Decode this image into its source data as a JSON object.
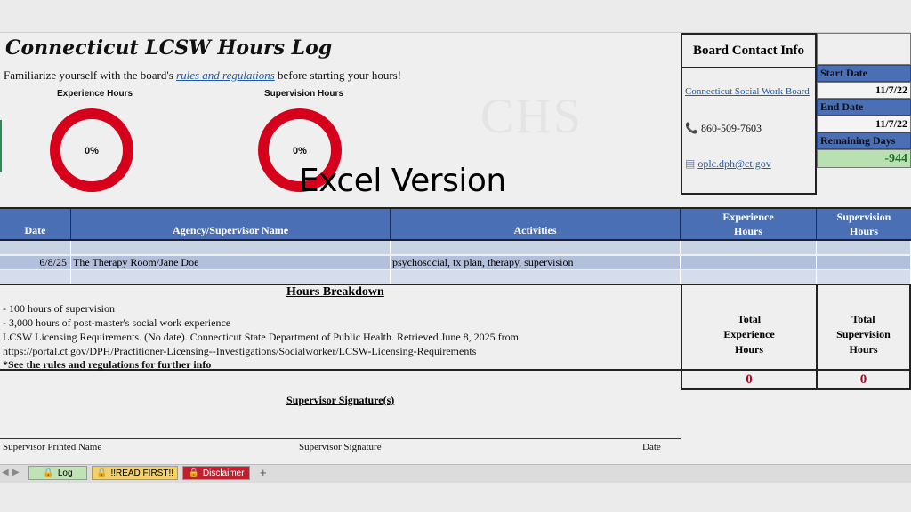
{
  "title": "Connecticut LCSW Hours Log",
  "intro": {
    "before": "Familiarize yourself with the board's ",
    "link": "rules and regulations",
    "after": " before starting your hours!"
  },
  "charts": {
    "experience_label": "Experience Hours",
    "experience_pct": "0%",
    "supervision_label": "Supervision Hours",
    "supervision_pct": "0%"
  },
  "chart_data": [
    {
      "type": "pie",
      "title": "Experience Hours",
      "values": [
        0,
        100
      ],
      "center_label": "0%",
      "colors": [
        "#4a6fb5",
        "#d6001c"
      ]
    },
    {
      "type": "pie",
      "title": "Supervision Hours",
      "values": [
        0,
        100
      ],
      "center_label": "0%",
      "colors": [
        "#4a6fb5",
        "#d6001c"
      ]
    }
  ],
  "overlay_text": "Excel Version",
  "watermark": "CHS",
  "contact": {
    "heading": "Board Contact Info",
    "board_link": "Connecticut Social Work Board",
    "phone": "860-509-7603",
    "email": "oplc.dph@ct.gov"
  },
  "dates": {
    "start_label": "Start Date",
    "start_value": "11/7/22",
    "end_label": "End Date",
    "end_value": "11/7/22",
    "remaining_label": "Remaining Days",
    "remaining_value": "-944"
  },
  "table": {
    "headers": {
      "date": "Date",
      "agency": "Agency/Supervisor Name",
      "activities": "Activities",
      "experience_1": "Experience",
      "experience_2": "Hours",
      "supervision_1": "Supervision",
      "supervision_2": "Hours"
    },
    "rows": [
      {
        "date": "",
        "agency": "",
        "activities": ""
      },
      {
        "date": "6/8/25",
        "agency": "The Therapy Room/Jane Doe",
        "activities": "psychosocial, tx plan, therapy, supervision"
      },
      {
        "date": "",
        "agency": "",
        "activities": ""
      }
    ]
  },
  "breakdown": {
    "title": "Hours Breakdown",
    "line1": "- 100 hours of supervision",
    "line2": "- 3,000 hours of post-master's social work experience",
    "line3": "LCSW Licensing Requirements. (No date). Connecticut State Department of Public Health. Retrieved June 8, 2025 from",
    "line4": "https://portal.ct.gov/DPH/Practitioner-Licensing--Investigations/Socialworker/LCSW-Licensing-Requirements",
    "line5": "*See the rules and regulations for further info"
  },
  "totals": {
    "experience_1": "Total",
    "experience_2": "Experience",
    "experience_3": "Hours",
    "experience_value": "0",
    "supervision_1": "Total",
    "supervision_2": "Supervision",
    "supervision_3": "Hours",
    "supervision_value": "0"
  },
  "signature": {
    "title": "Supervisor Signature(s)",
    "printed_name": "Supervisor Printed Name",
    "signature": "Supervisor Signature",
    "date": "Date"
  },
  "tabs": [
    {
      "label": "Log",
      "color": "#bfe3b4"
    },
    {
      "label": "!!READ FIRST!!",
      "color": "#f2d06b"
    },
    {
      "label": "Disclaimer",
      "color": "#c0202e"
    }
  ],
  "tab_add": "+"
}
